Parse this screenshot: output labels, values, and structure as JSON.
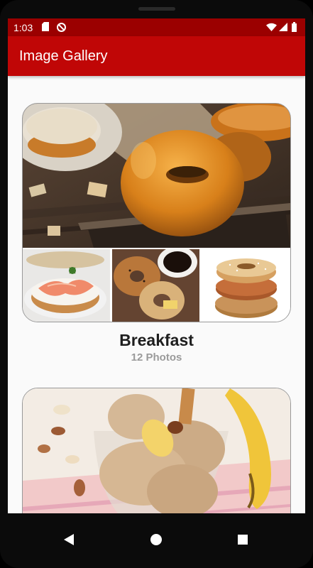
{
  "status_bar": {
    "time": "1:03",
    "icons": [
      "sd-card-icon",
      "sync-icon",
      "wifi-icon",
      "signal-icon",
      "battery-icon"
    ]
  },
  "app_bar": {
    "title": "Image Gallery",
    "color": "#c00606",
    "status_color": "#9b0000"
  },
  "albums": [
    {
      "title": "Breakfast",
      "count": "12 Photos",
      "images": [
        "bagel-hero-image",
        "salmon-bagel-image",
        "bagels-coffee-image",
        "bagel-stack-image"
      ]
    },
    {
      "images": [
        "banana-ice-cream-image"
      ]
    }
  ],
  "nav": {
    "buttons": [
      "back-icon",
      "home-icon",
      "recents-icon"
    ]
  }
}
